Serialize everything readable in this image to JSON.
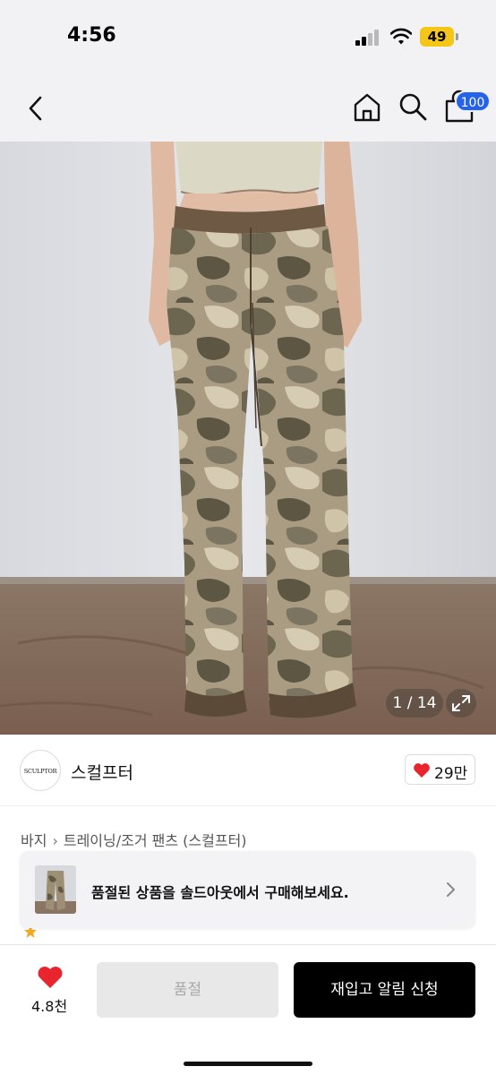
{
  "status_bar": {
    "time": "4:56",
    "battery": "49",
    "icons": [
      "signal-icon",
      "wifi-icon",
      "battery-icon"
    ]
  },
  "nav": {
    "icons": [
      "back-icon",
      "home-icon",
      "search-icon",
      "cart-icon"
    ],
    "cart_badge": "100",
    "accent_color": "#2563eb"
  },
  "gallery": {
    "counter": "1 / 14",
    "current": 1,
    "total": 14,
    "expand_icon": "expand-icon"
  },
  "brand": {
    "logo_text": "SCULPTOR",
    "name": "스컬프터",
    "likes": "29만",
    "like_icon": "heart-icon",
    "like_color": "#e8242c"
  },
  "breadcrumb": {
    "category": "바지",
    "subcategory": "트레이닝/조거 팬츠 (스컬프터)"
  },
  "soldout_banner": {
    "text": "품절된 상품을 솔드아웃에서 구매해보세요."
  },
  "bottom_bar": {
    "wish_count": "4.8천",
    "soldout_label": "품절",
    "restock_label": "재입고 알림 신청"
  }
}
